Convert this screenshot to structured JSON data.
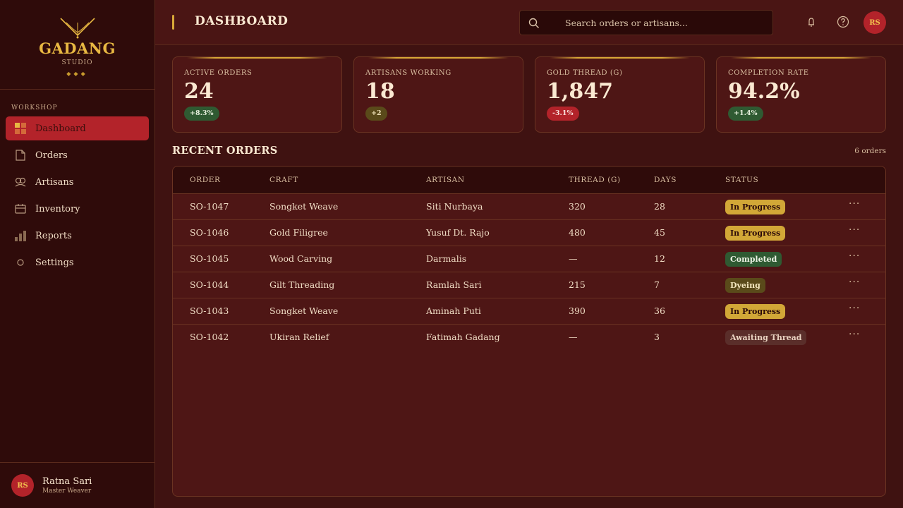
{
  "brand": {
    "name": "GADANG",
    "sub": "STUDIO",
    "dots": "◆◆◆"
  },
  "sidebar": {
    "section": "WORKSHOP",
    "items": [
      {
        "label": "Dashboard",
        "icon": "dashboard-icon",
        "active": true
      },
      {
        "label": "Orders",
        "icon": "document-icon"
      },
      {
        "label": "Artisans",
        "icon": "people-icon"
      },
      {
        "label": "Inventory",
        "icon": "box-icon"
      },
      {
        "label": "Reports",
        "icon": "bar-chart-icon"
      },
      {
        "label": "Settings",
        "icon": "gear-icon"
      }
    ],
    "user": {
      "initials": "RS",
      "name": "Ratna Sari",
      "role": "Master Weaver"
    }
  },
  "header": {
    "title": "DASHBOARD",
    "search_placeholder": "Search orders or artisans...",
    "avatar_initials": "RS"
  },
  "stats": [
    {
      "label": "ACTIVE ORDERS",
      "value": "24",
      "delta": "+8.3%",
      "tone": "green"
    },
    {
      "label": "ARTISANS WORKING",
      "value": "18",
      "delta": "+2",
      "tone": "olive"
    },
    {
      "label": "GOLD THREAD (G)",
      "value": "1,847",
      "delta": "-3.1%",
      "tone": "red"
    },
    {
      "label": "COMPLETION RATE",
      "value": "94.2%",
      "delta": "+1.4%",
      "tone": "green"
    }
  ],
  "orders": {
    "title": "RECENT ORDERS",
    "count": "6 orders",
    "columns": [
      "ORDER",
      "CRAFT",
      "ARTISAN",
      "THREAD (G)",
      "DAYS",
      "STATUS"
    ],
    "rows": [
      {
        "id": "SO-1047",
        "craft": "Songket Weave",
        "artisan": "Siti Nurbaya",
        "thread": "320",
        "days": "28",
        "status": "In Progress",
        "kind": "progress"
      },
      {
        "id": "SO-1046",
        "craft": "Gold Filigree",
        "artisan": "Yusuf Dt. Rajo",
        "thread": "480",
        "days": "45",
        "status": "In Progress",
        "kind": "progress"
      },
      {
        "id": "SO-1045",
        "craft": "Wood Carving",
        "artisan": "Darmalis",
        "thread": "—",
        "days": "12",
        "status": "Completed",
        "kind": "completed"
      },
      {
        "id": "SO-1044",
        "craft": "Gilt Threading",
        "artisan": "Ramlah Sari",
        "thread": "215",
        "days": "7",
        "status": "Dyeing",
        "kind": "dyeing"
      },
      {
        "id": "SO-1043",
        "craft": "Songket Weave",
        "artisan": "Aminah Puti",
        "thread": "390",
        "days": "36",
        "status": "In Progress",
        "kind": "progress"
      },
      {
        "id": "SO-1042",
        "craft": "Ukiran Relief",
        "artisan": "Fatimah Gadang",
        "thread": "—",
        "days": "3",
        "status": "Awaiting Thread",
        "kind": "awaiting"
      }
    ],
    "more_label": "···"
  },
  "colors": {
    "accent": "#b3232a",
    "gold": "#d8a838",
    "bg": "#3f1211"
  }
}
